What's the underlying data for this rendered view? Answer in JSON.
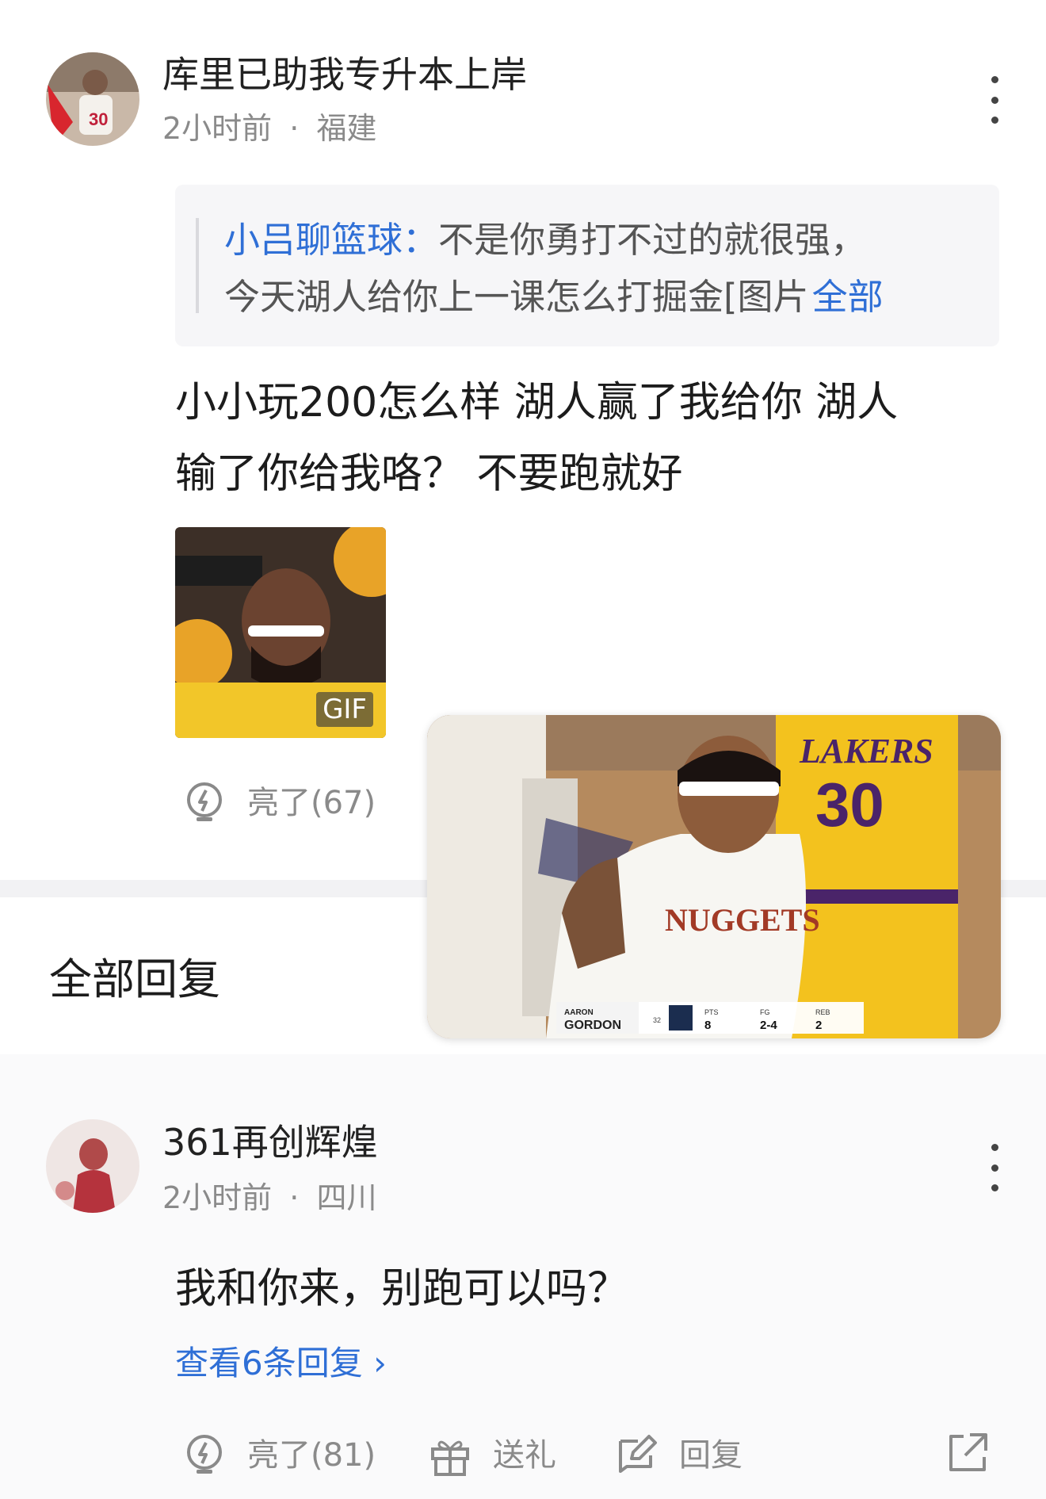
{
  "comment1": {
    "username": "库里已助我专升本上岸",
    "time": "2小时前",
    "separator": "·",
    "location": "福建",
    "quote": {
      "author": "小吕聊篮球：",
      "line1": "不是你勇打不过的就很强，",
      "line2": "今天湖人给你上一课怎么打掘金[图片",
      "more_label": "全部"
    },
    "text_line1": "小小玩200怎么样 湖人赢了我给你 湖人",
    "text_line2": "输了你给我咯？ 不要跑就好",
    "gif_badge": "GIF",
    "like_label": "亮了(67)"
  },
  "section_title": "全部回复",
  "comment2": {
    "username": "361再创辉煌",
    "time": "2小时前",
    "separator": "·",
    "location": "四川",
    "text": "我和你来，别跑可以吗？",
    "view_replies": "查看6条回复 ›",
    "like_label": "亮了(81)",
    "gift_label": "送礼",
    "reply_label": "回复"
  },
  "video_overlay": {
    "jersey_team": "LAKERS",
    "jersey_number": "30",
    "nuggets_text": "NUGGETS",
    "scorebug": {
      "first_name": "AARON",
      "last_name": "GORDON",
      "jersey": "32",
      "pts_label": "PTS",
      "pts": "8",
      "fg_label": "FG",
      "fg": "2-4",
      "reb_label": "REB",
      "reb": "2"
    }
  },
  "colors": {
    "link_blue": "#2f6fd6",
    "meta_gray": "#8a8a8a",
    "lakers_gold": "#f2c21b",
    "lakers_purple": "#55256f"
  }
}
